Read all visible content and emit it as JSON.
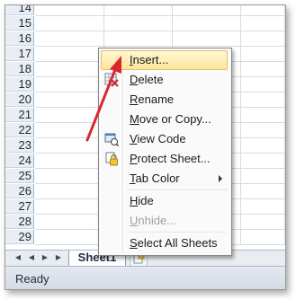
{
  "grid": {
    "row_numbers": [
      "14",
      "15",
      "16",
      "17",
      "18",
      "19",
      "20",
      "21",
      "22",
      "23",
      "24",
      "25",
      "26",
      "27",
      "28",
      "29"
    ]
  },
  "sheet_tabs": {
    "nav_first": "◀",
    "nav_prev": "◀",
    "nav_next": "▶",
    "nav_last": "▶",
    "active_tab": "Sheet1"
  },
  "status_bar": {
    "text": "Ready"
  },
  "context_menu": {
    "items": [
      {
        "accel": "I",
        "rest": "nsert..."
      },
      {
        "accel": "D",
        "rest": "elete"
      },
      {
        "accel": "R",
        "rest": "ename"
      },
      {
        "accel": "M",
        "rest": "ove or Copy..."
      },
      {
        "accel": "V",
        "rest": "iew Code"
      },
      {
        "accel": "P",
        "rest": "rotect Sheet..."
      },
      {
        "accel": "T",
        "rest": "ab Color"
      },
      {
        "accel": "H",
        "rest": "ide"
      },
      {
        "accel": "U",
        "rest": "nhide..."
      },
      {
        "accel": "S",
        "rest": "elect All Sheets"
      }
    ]
  },
  "colors": {
    "hover_fill": "#fde59a",
    "annotation_arrow": "#d9272e"
  },
  "icons": [
    "delete-sheet-icon",
    "view-code-icon",
    "protect-sheet-icon",
    "new-sheet-icon"
  ]
}
